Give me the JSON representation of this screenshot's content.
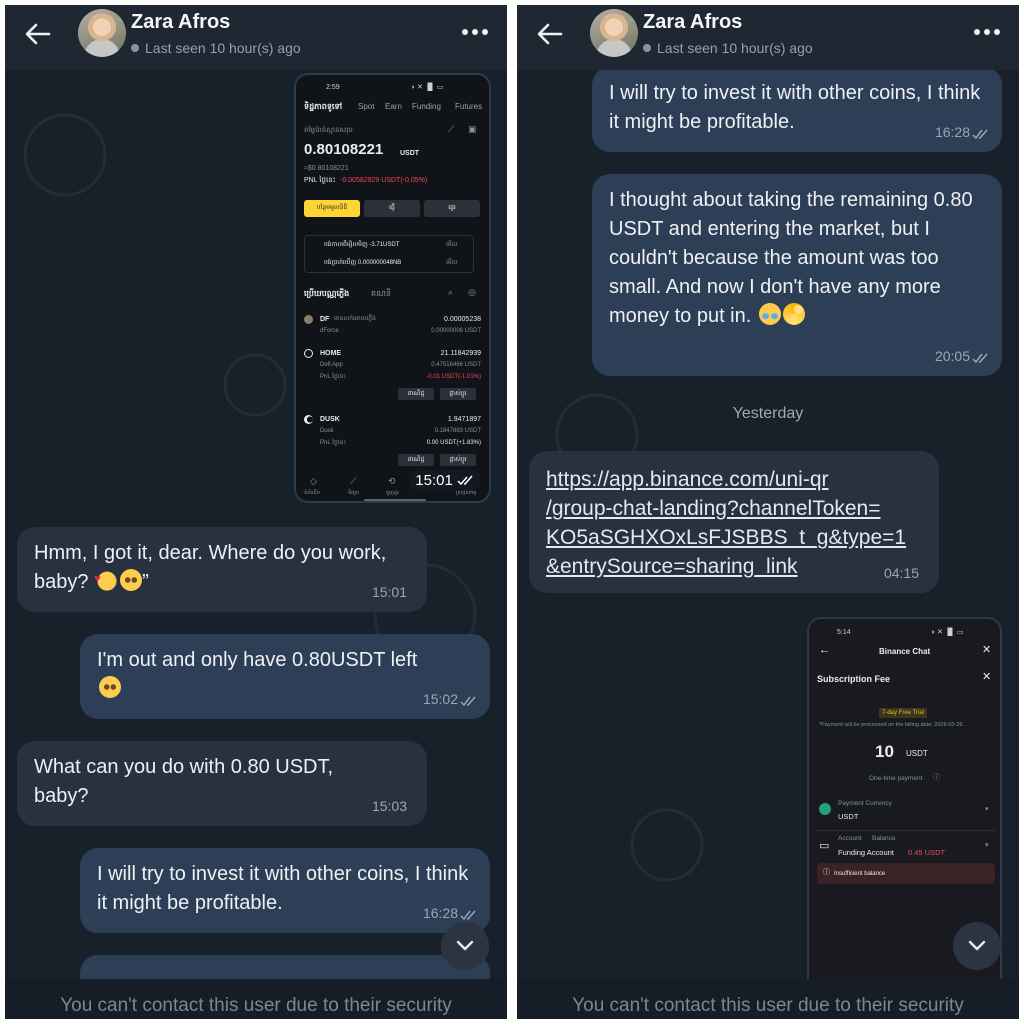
{
  "contact": {
    "name": "Zara Afros",
    "last_seen": "Last seen 10 hour(s) ago"
  },
  "left": {
    "image_time": "15:01",
    "messages": [
      {
        "dir": "in",
        "text": "Hmm, I got it, dear. Where do you work, baby? ",
        "tail": "”",
        "time": "15:01"
      },
      {
        "dir": "out",
        "text": "I'm out and only have 0.80USDT left",
        "time": "15:02"
      },
      {
        "dir": "in",
        "text": "What can you do with 0.80 USDT, baby?",
        "time": "15:03"
      },
      {
        "dir": "out",
        "text": "I will try to invest it with other coins, I think it might be profitable.",
        "time": "16:28"
      }
    ]
  },
  "right": {
    "messages": [
      {
        "dir": "out",
        "text": "I will try to invest it with other coins, I think it might be profitable.",
        "time": "16:28"
      },
      {
        "dir": "out",
        "text": "I thought about taking the remaining 0.80 USDT and entering the market, but I couldn't because the amount was too small. And now I don't have any more money to put in. ",
        "time": "20:05"
      }
    ],
    "date_separator": "Yesterday",
    "link_message": {
      "lines": [
        "https://app.binance.com/uni-qr",
        "/group-chat-landing?channelToken=",
        "KO5aSGHXOxLsFJSBBS_t_g&type=1",
        "&entrySource=sharing_link"
      ],
      "time": "04:15"
    }
  },
  "footer": {
    "text": "You can't contact this user due to their security"
  },
  "wallet_screenshot": {
    "status_time": "2:59",
    "tabs": [
      "ទិដ្ឋភាពទូទៅ",
      "Spot",
      "Earn",
      "Funding",
      "Futures"
    ],
    "estimated_label": "តម្លៃប៉ាន់ស្មានសរុប",
    "balance": "0.80108221",
    "balance_unit": "USDT",
    "balance_usd": "≈$0.80108221",
    "pnl_label": "PNL ថ្ងៃនេះ",
    "pnl_value": "-0.00582929 USDT(-0.05%)",
    "buttons": [
      "បន្ថែមមូលនិធិ",
      "ផ្ញើ",
      "ផ្ទេរ"
    ],
    "notices": [
      {
        "text": "បង់កាលពីម្សិលមិញ -3.71USDT",
        "action": "មើល"
      },
      {
        "text": "បង់ប្រាក់ឃើញ 0.000000048NB",
        "action": "មើល"
      }
    ],
    "list_tabs": [
      "ប្រើឃបណ្ណភ្លើង",
      "គណនី"
    ],
    "coins": [
      {
        "sym": "DF",
        "note": "មានលក់អោយភ្លើង",
        "sub": "dForce",
        "amount": "0.00005238",
        "amount_sub": "0.00000006 USDT"
      },
      {
        "sym": "HOME",
        "sub": "Defi App",
        "amount": "21.11842939",
        "amount_sub": "0.47516466 USDT",
        "pnl_label": "PnL ថ្ងៃនេះ",
        "pnl": "-0.01 USDT(-1.01%)",
        "actions": [
          "ពាណិជ្ជ",
          "ផ្លាស់ប្ដូរ"
        ]
      },
      {
        "sym": "DUSK",
        "sub": "Dusk",
        "amount": "1.9471897",
        "amount_sub": "0.1847883 USDT",
        "pnl_label": "PnL ថ្ងៃនេះ",
        "pnl": "0.00 USDT(+1.83%)",
        "actions": [
          "ពាណិជ្ជ",
          "ផ្លាស់ប្ដូរ"
        ]
      }
    ],
    "nav": [
      "ទំព័រដើម",
      "ទីផ្សារ",
      "ជួញដូរ",
      "",
      "ទ្រព្យសកម្ម"
    ]
  },
  "binance_screenshot": {
    "status_time": "5:14",
    "title": "Binance Chat",
    "sheet_title": "Subscription Fee",
    "trial_badge": "7-day Free Trial",
    "billing_note": "*Payment will be processed on the billing date: 2026-03-26.",
    "amount": "10",
    "amount_unit": "USDT",
    "payment_type": "One-time payment",
    "currency_label": "Payment Currency",
    "currency_value": "USDT",
    "account_label": "Account",
    "balance_label": "Balance",
    "account_value": "Funding Account",
    "account_balance": "0.45 USDT",
    "warning": "Insufficient balance"
  },
  "colors": {
    "bubble_in": "#283140",
    "bubble_out": "#2d3f57",
    "background": "#18202a",
    "binance_yellow": "#fcd535",
    "negative": "#f6465d"
  }
}
